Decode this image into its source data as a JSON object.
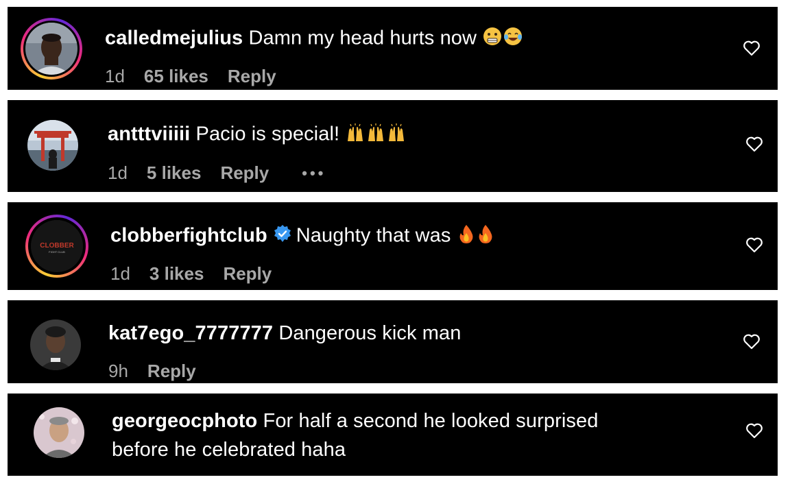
{
  "comments": [
    {
      "username": "calledmejulius",
      "text": "Damn my head hurts now",
      "time": "1d",
      "likes": "65 likes",
      "reply": "Reply",
      "emoji": [
        "grimacing-face-emoji",
        "tears-of-joy-emoji"
      ],
      "ring": true
    },
    {
      "username": "antttviiiii",
      "text": "Pacio is special!",
      "time": "1d",
      "likes": "5 likes",
      "reply": "Reply",
      "more": "•••",
      "emoji": [
        "raising-hands-emoji",
        "raising-hands-emoji",
        "raising-hands-emoji"
      ],
      "ring": false
    },
    {
      "username": "clobberfightclub",
      "text": "Naughty that was",
      "time": "1d",
      "likes": "3 likes",
      "reply": "Reply",
      "verified": true,
      "emoji": [
        "fire-emoji",
        "fire-emoji"
      ],
      "ring": true,
      "avatar_text": "CLOBBER",
      "avatar_subtext": "FIGHT CLUB"
    },
    {
      "username": "kat7ego_7777777",
      "text": "Dangerous kick man",
      "time": "9h",
      "reply": "Reply",
      "ring": false
    },
    {
      "username": "georgeocphoto",
      "text_line1": "For half a second he looked surprised",
      "text_line2": "before he celebrated haha",
      "ring": false
    }
  ],
  "colors": {
    "background": "#000000",
    "page": "#ffffff",
    "primary_text": "#ffffff",
    "secondary_text": "#a8a8a8",
    "verified_blue": "#3897f0"
  }
}
